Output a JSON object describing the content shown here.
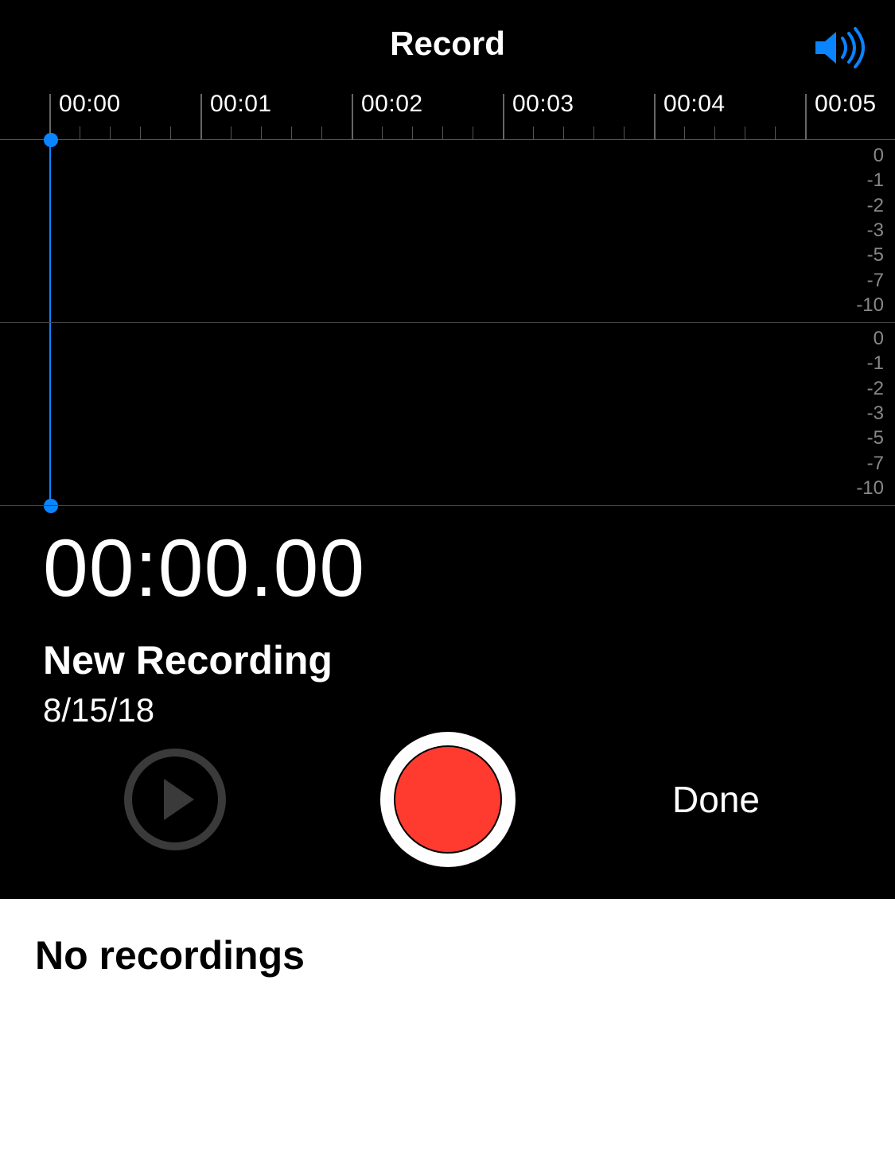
{
  "header": {
    "title": "Record"
  },
  "ruler": {
    "labels": [
      "00:00",
      "00:01",
      "00:02",
      "00:03",
      "00:04",
      "00:05"
    ]
  },
  "db_scale": {
    "top": [
      "0",
      "-1",
      "-2",
      "-3",
      "-5",
      "-7",
      "-10"
    ],
    "bottom": [
      "-10",
      "-7",
      "-5",
      "-3",
      "-2",
      "-1",
      "0"
    ]
  },
  "recording": {
    "elapsed": "00:00.00",
    "name": "New Recording",
    "date": "8/15/18"
  },
  "controls": {
    "done_label": "Done"
  },
  "footer": {
    "empty_label": "No recordings"
  }
}
